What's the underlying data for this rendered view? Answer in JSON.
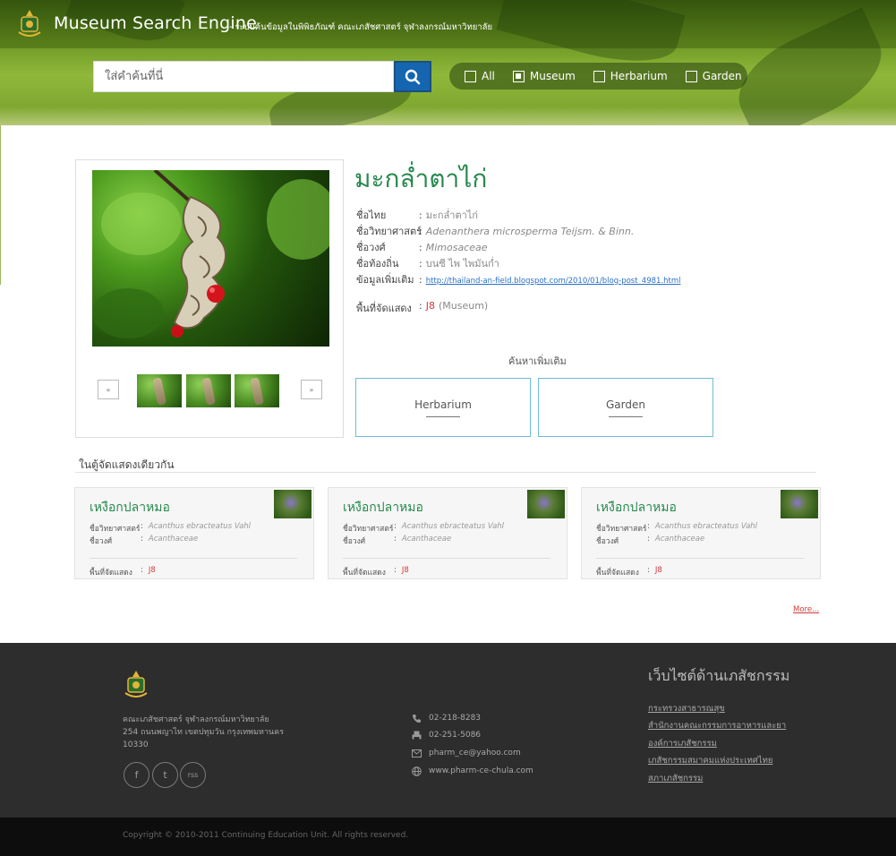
{
  "header": {
    "site_title": "Museum Search Engine",
    "site_subtitle": "- ระบบค้นข้อมูลในพิพิธภัณฑ์ คณะเภสัชศาสตร์ จุฬาลงกรณ์มหาวิทยาลัย",
    "search_placeholder": "ใส่คำค้นที่นี่",
    "filters": [
      {
        "label": "All",
        "checked": false
      },
      {
        "label": "Museum",
        "checked": true
      },
      {
        "label": "Herbarium",
        "checked": false
      },
      {
        "label": "Garden",
        "checked": false
      }
    ]
  },
  "detail": {
    "title": "มะกล่ำตาไก่",
    "fields": [
      {
        "label": "ชื่อไทย",
        "value": "มะกล่ำตาไก่",
        "italic": false
      },
      {
        "label": "ชื่อวิทยาศาสตร์",
        "value": "Adenanthera microsperma Teijsm. & Binn.",
        "italic": true
      },
      {
        "label": "ชื่อวงศ์",
        "value": "Mimosaceae",
        "italic": true
      },
      {
        "label": "ชื่อท้องถิ่น",
        "value": "บนซี ไพ ไพมันก่ำ",
        "italic": false
      }
    ],
    "extra_label": "ข้อมูลเพิ่มเติม",
    "extra_link": "http://thailand-an-field.blogspot.com/2010/01/blog-post_4981.html",
    "exhibit_label": "พื้นที่จัดแสดง",
    "exhibit_code": "J8",
    "exhibit_location": "(Museum)",
    "prev_label": "«",
    "next_label": "»"
  },
  "more_search": {
    "title": "ค้นหาเพิ่มเติม",
    "buttons": [
      "Herbarium",
      "Garden"
    ]
  },
  "related": {
    "title": "ในตู้จัดแสดงเดียวกัน",
    "cards": [
      {
        "title": "เหงือกปลาหมอ",
        "sci_label": "ชื่อวิทยาศาสตร์",
        "sci": "Acanthus ebracteatus Vahl",
        "family_label": "ชื่อวงศ์",
        "family": "Acanthaceae",
        "exhibit_label": "พื้นที่จัดแสดง",
        "exhibit": "J8"
      },
      {
        "title": "เหงือกปลาหมอ",
        "sci_label": "ชื่อวิทยาศาสตร์",
        "sci": "Acanthus ebracteatus Vahl",
        "family_label": "ชื่อวงศ์",
        "family": "Acanthaceae",
        "exhibit_label": "พื้นที่จัดแสดง",
        "exhibit": "J8"
      },
      {
        "title": "เหงือกปลาหมอ",
        "sci_label": "ชื่อวิทยาศาสตร์",
        "sci": "Acanthus ebracteatus Vahl",
        "family_label": "ชื่อวงศ์",
        "family": "Acanthaceae",
        "exhibit_label": "พื้นที่จัดแสดง",
        "exhibit": "J8"
      }
    ],
    "more_label": "More..."
  },
  "footer": {
    "address": [
      "คณะเภสัชศาสตร์ จุฬาลงกรณ์มหาวิทยาลัย",
      "254 ถนนพญาไท เขตปทุมวัน กรุงเทพมหานคร",
      "10330"
    ],
    "social": [
      "f",
      "t",
      "rss"
    ],
    "contacts": [
      {
        "icon": "phone-icon",
        "text": "02-218-8283"
      },
      {
        "icon": "fax-icon",
        "text": "02-251-5086"
      },
      {
        "icon": "mail-icon",
        "text": "pharm_ce@yahoo.com"
      },
      {
        "icon": "globe-icon",
        "text": "www.pharm-ce-chula.com"
      }
    ],
    "links_title": "เว็บไซต์ด้านเภสัชกรรม",
    "links": [
      "กระทรวงสาธารณสุข",
      "สำนักงานคณะกรรมการอาหารและยา",
      "องค์การเภสัชกรรม",
      "เภสัชกรรมสมาคมแห่งประเทศไทย",
      "สภาเภสัชกรรม"
    ],
    "copyright": "Copyright © 2010-2011 Continuing Education Unit. All rights reserved."
  },
  "colors": {
    "accent_green": "#27894d",
    "search_blue": "#1565b0",
    "exhibit_red": "#d43a3a",
    "link_blue": "#2a70c8",
    "footer_bg": "#2d2d2d"
  }
}
